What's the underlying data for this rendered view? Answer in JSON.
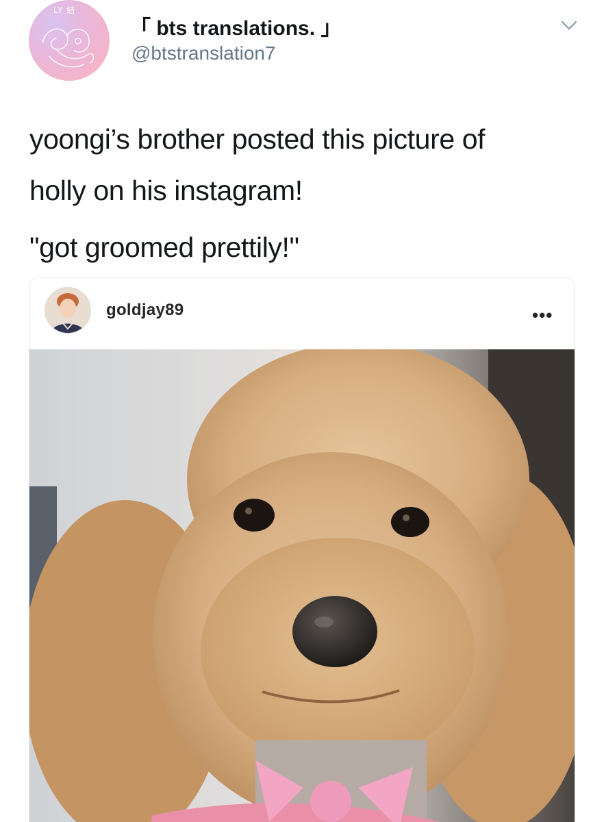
{
  "tweet": {
    "avatar_mark": "LY 結",
    "display_name": "「 bts translations. 」",
    "handle": "@btstranslation7",
    "text_line1": "yoongi’s brother posted this picture of",
    "text_line2": "holly on his instagram!",
    "quote": "\"got groomed prettily!\"",
    "menu_icon": "chevron-down-icon"
  },
  "instagram_embed": {
    "username": "goldjay89",
    "more_label": "•••",
    "photo_subject": "apricot toy poodle with pink bow",
    "colors": {
      "fur": "#d9b48a",
      "bow": "#f2a6c4"
    }
  },
  "colors": {
    "text": "#14171a",
    "secondary": "#657786",
    "border": "#e1e8ed"
  }
}
